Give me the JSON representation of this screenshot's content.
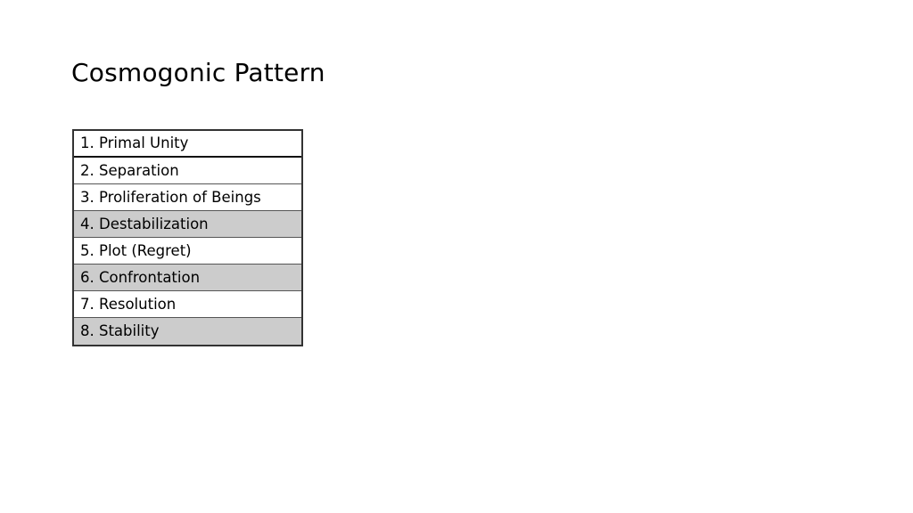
{
  "slide": {
    "title": "Cosmogonic Pattern",
    "background_color": "#ffffff",
    "text_color": "#000000"
  },
  "table": {
    "shaded_color": "#cccccc",
    "unshaded_color": "#ffffff",
    "border_color": "#333333",
    "rows": [
      {
        "number": "1.",
        "label": "1. Primal Unity",
        "shaded": false
      },
      {
        "number": "2.",
        "label": "2. Separation",
        "shaded": false
      },
      {
        "number": "3.",
        "label": "3. Proliferation of Beings",
        "shaded": false
      },
      {
        "number": "4.",
        "label": "4. Destabilization",
        "shaded": true
      },
      {
        "number": "5.",
        "label": "5. Plot (Regret)",
        "shaded": false
      },
      {
        "number": "6.",
        "label": "6. Confrontation",
        "shaded": true
      },
      {
        "number": "7.",
        "label": "7. Resolution",
        "shaded": false
      },
      {
        "number": "8.",
        "label": "8. Stability",
        "shaded": true
      }
    ]
  }
}
